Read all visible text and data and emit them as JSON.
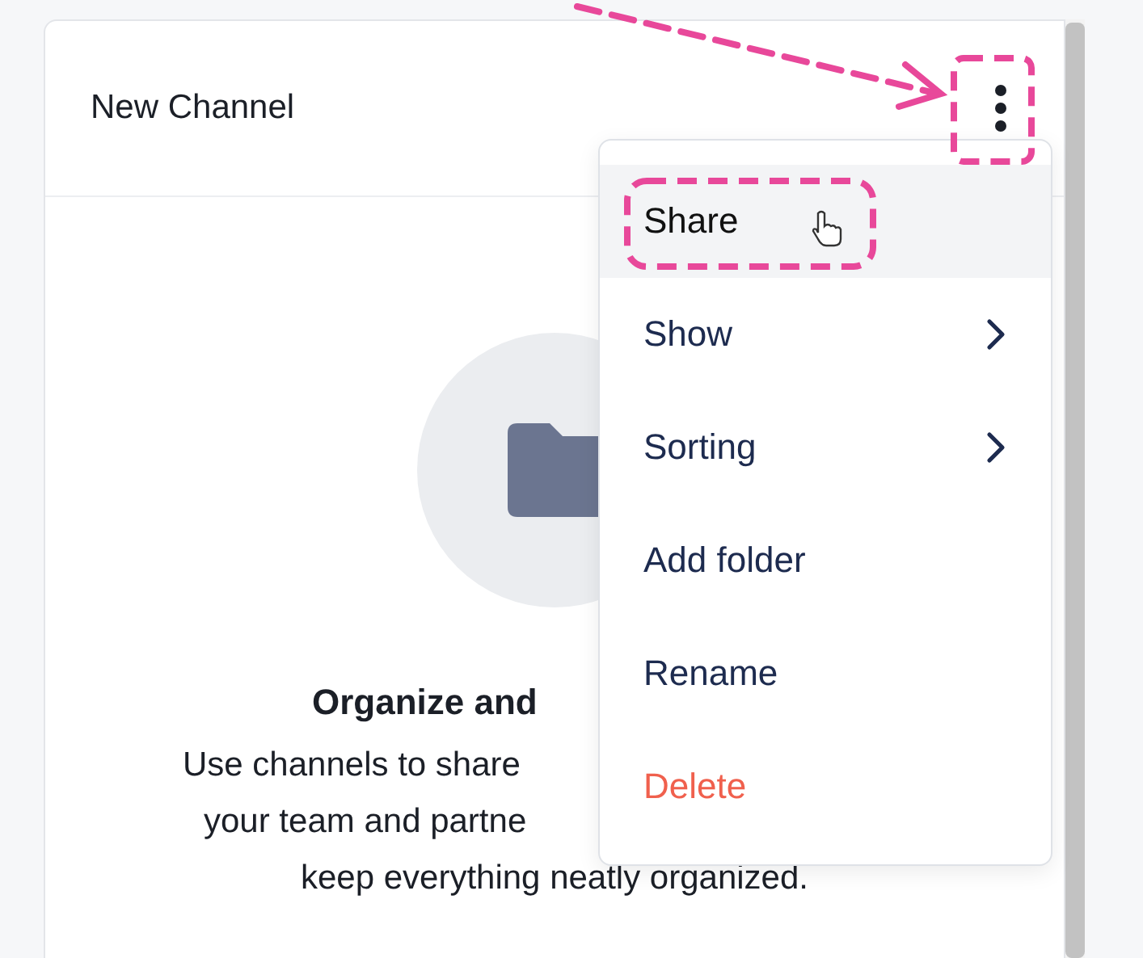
{
  "header": {
    "title": "New Channel"
  },
  "empty_state": {
    "heading": "Organize and",
    "lines": [
      "Use channels to share",
      "your team and partne",
      "keep everything neatly organized."
    ]
  },
  "menu": {
    "items": [
      {
        "label": "Share",
        "kind": "plain",
        "highlighted": true
      },
      {
        "label": "Show",
        "kind": "submenu",
        "highlighted": false
      },
      {
        "label": "Sorting",
        "kind": "submenu",
        "highlighted": false
      },
      {
        "label": "Add folder",
        "kind": "plain",
        "highlighted": false
      },
      {
        "label": "Rename",
        "kind": "plain",
        "highlighted": false
      },
      {
        "label": "Delete",
        "kind": "danger",
        "highlighted": false
      }
    ]
  }
}
